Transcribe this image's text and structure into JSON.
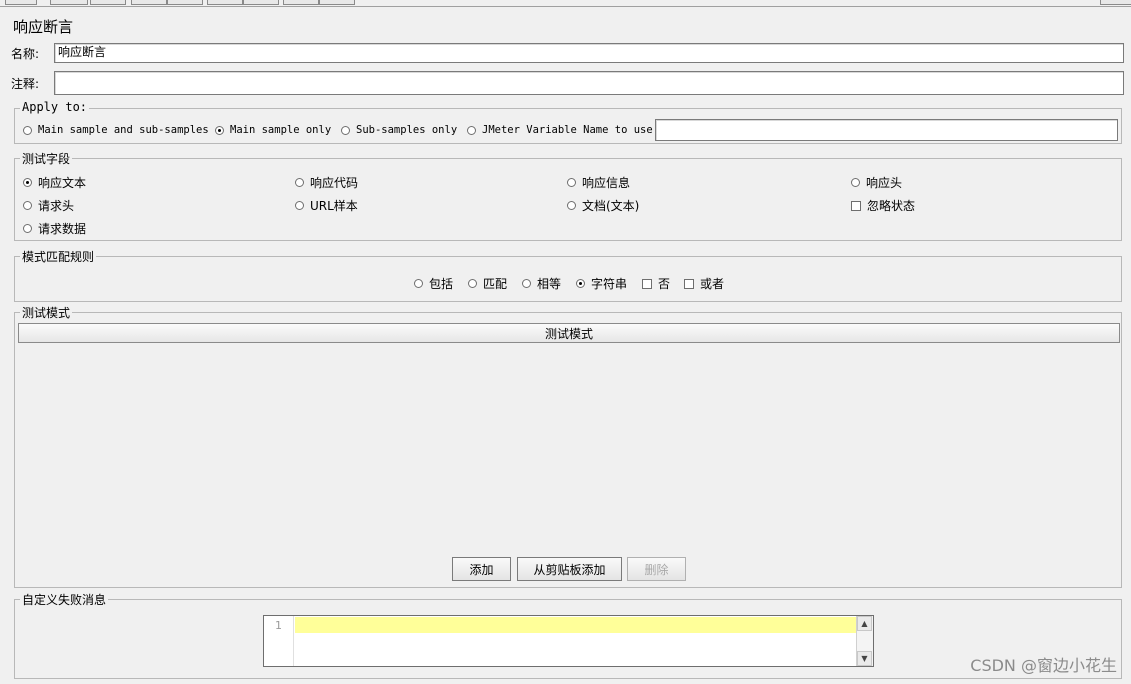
{
  "panel": {
    "title": "响应断言",
    "name_label": "名称:",
    "name_value": "响应断言",
    "comment_label": "注释:",
    "comment_value": ""
  },
  "apply_to": {
    "legend": "Apply to:",
    "options": [
      "Main sample and sub-samples",
      "Main sample only",
      "Sub-samples only",
      "JMeter Variable Name to use"
    ],
    "selected": "Main sample only",
    "variable_value": ""
  },
  "test_field": {
    "legend": "测试字段",
    "options": [
      "响应文本",
      "响应代码",
      "响应信息",
      "响应头",
      "请求头",
      "URL样本",
      "文档(文本)",
      "请求数据"
    ],
    "selected": "响应文本",
    "ignore_status_label": "忽略状态"
  },
  "match_rules": {
    "legend": "模式匹配规则",
    "options": [
      "包括",
      "匹配",
      "相等",
      "字符串"
    ],
    "selected": "字符串",
    "not_label": "否",
    "or_label": "或者"
  },
  "patterns": {
    "legend": "测试模式",
    "column_header": "测试模式",
    "add_button": "添加",
    "add_clipboard_button": "从剪贴板添加",
    "delete_button": "删除"
  },
  "failure_message": {
    "legend": "自定义失败消息",
    "line_number": "1"
  },
  "watermark": "CSDN @窗边小花生"
}
